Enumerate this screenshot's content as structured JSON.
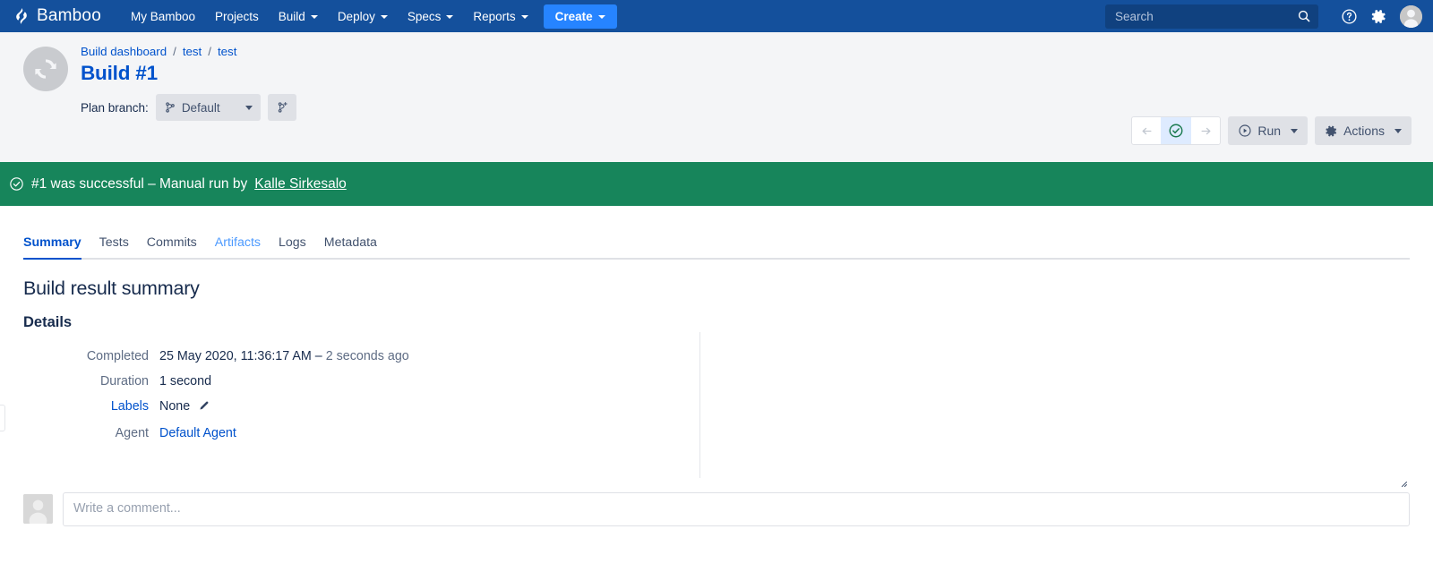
{
  "navbar": {
    "brand": "Bamboo",
    "items": [
      {
        "label": "My Bamboo",
        "caret": false
      },
      {
        "label": "Projects",
        "caret": false
      },
      {
        "label": "Build",
        "caret": true
      },
      {
        "label": "Deploy",
        "caret": true
      },
      {
        "label": "Specs",
        "caret": true
      },
      {
        "label": "Reports",
        "caret": true
      }
    ],
    "create_label": "Create",
    "search_placeholder": "Search",
    "search_value": "",
    "colors": {
      "bar": "#14509C",
      "create": "#2684FF"
    }
  },
  "header": {
    "breadcrumb": [
      {
        "label": "Build dashboard"
      },
      {
        "label": "test"
      },
      {
        "label": "test"
      }
    ],
    "breadcrumb_separator": "/",
    "title": "Build #1",
    "plan_branch_label": "Plan branch:",
    "plan_branch_value": "Default",
    "run_label": "Run",
    "actions_label": "Actions"
  },
  "banner": {
    "text": "#1 was successful – Manual run by ",
    "user": "Kalle Sirkesalo",
    "color": "#17855B"
  },
  "tabs": [
    {
      "label": "Summary",
      "state": "active"
    },
    {
      "label": "Tests",
      "state": "normal"
    },
    {
      "label": "Commits",
      "state": "normal"
    },
    {
      "label": "Artifacts",
      "state": "hovered"
    },
    {
      "label": "Logs",
      "state": "normal"
    },
    {
      "label": "Metadata",
      "state": "normal"
    }
  ],
  "summary": {
    "title": "Build result summary",
    "details_heading": "Details",
    "rows": [
      {
        "label": "Completed",
        "value": "25 May 2020, 11:36:17 AM – ",
        "value_muted": "2 seconds ago",
        "label_link": false,
        "value_link": false
      },
      {
        "label": "Duration",
        "value": "1 second",
        "value_muted": "",
        "label_link": false,
        "value_link": false
      },
      {
        "label": "Labels",
        "value": "None",
        "value_muted": "",
        "label_link": true,
        "value_link": false,
        "edit_icon": true
      },
      {
        "label": "Agent",
        "value": "Default Agent",
        "value_muted": "",
        "label_link": false,
        "value_link": true
      }
    ]
  },
  "comment": {
    "placeholder": "Write a comment...",
    "value": ""
  }
}
